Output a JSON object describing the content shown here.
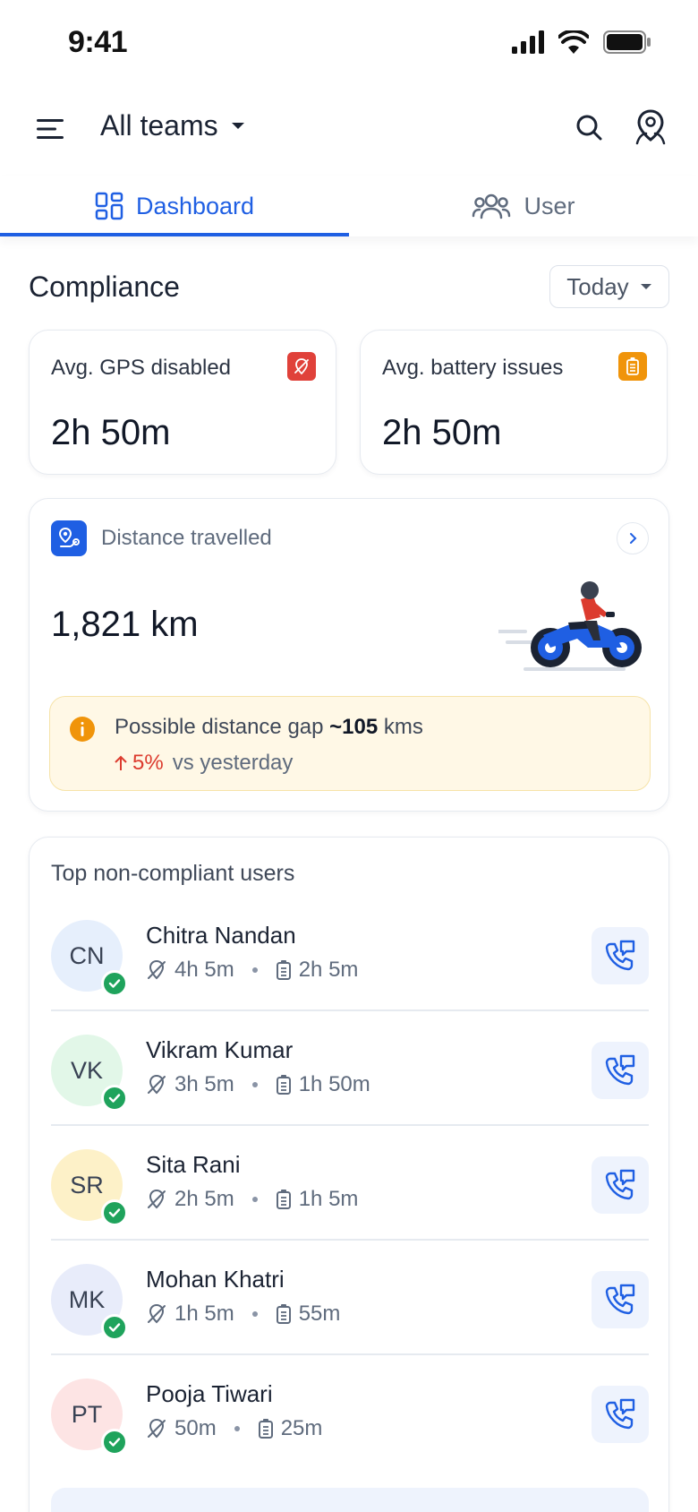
{
  "status_bar": {
    "time": "9:41"
  },
  "header": {
    "team_label": "All teams"
  },
  "tabs": [
    {
      "label": "Dashboard",
      "active": true
    },
    {
      "label": "User",
      "active": false
    }
  ],
  "compliance": {
    "title": "Compliance",
    "range": "Today",
    "gps": {
      "label": "Avg. GPS disabled",
      "value": "2h 50m",
      "color": "#e0413a"
    },
    "battery": {
      "label": "Avg. battery issues",
      "value": "2h 50m",
      "color": "#f0940a"
    }
  },
  "distance": {
    "label": "Distance travelled",
    "value": "1,821 km",
    "gap_prefix": "Possible distance gap ",
    "gap_value": "~105",
    "gap_suffix": " kms",
    "change": "5%",
    "compare": "vs yesterday"
  },
  "users": {
    "title": "Top non-compliant users",
    "list": [
      {
        "initials": "CN",
        "name": "Chitra Nandan",
        "gps": "4h 5m",
        "battery": "2h 5m",
        "bg": "#e6effc"
      },
      {
        "initials": "VK",
        "name": "Vikram Kumar",
        "gps": "3h 5m",
        "battery": "1h 50m",
        "bg": "#e2f7e8"
      },
      {
        "initials": "SR",
        "name": "Sita Rani",
        "gps": "2h 5m",
        "battery": "1h 5m",
        "bg": "#fdf1c8"
      },
      {
        "initials": "MK",
        "name": "Mohan Khatri",
        "gps": "1h 5m",
        "battery": "55m",
        "bg": "#e8ecfa"
      },
      {
        "initials": "PT",
        "name": "Pooja Tiwari",
        "gps": "50m",
        "battery": "25m",
        "bg": "#fde4e4"
      }
    ]
  },
  "icons": [
    "menu-icon",
    "caret-down-icon",
    "search-icon",
    "map-pin-people-icon",
    "dashboard-icon",
    "users-icon",
    "gps-off-icon",
    "battery-icon",
    "route-icon",
    "chevron-right-icon",
    "info-icon",
    "arrow-up-icon",
    "check-icon",
    "call-icon",
    "motorbike-illustration"
  ]
}
